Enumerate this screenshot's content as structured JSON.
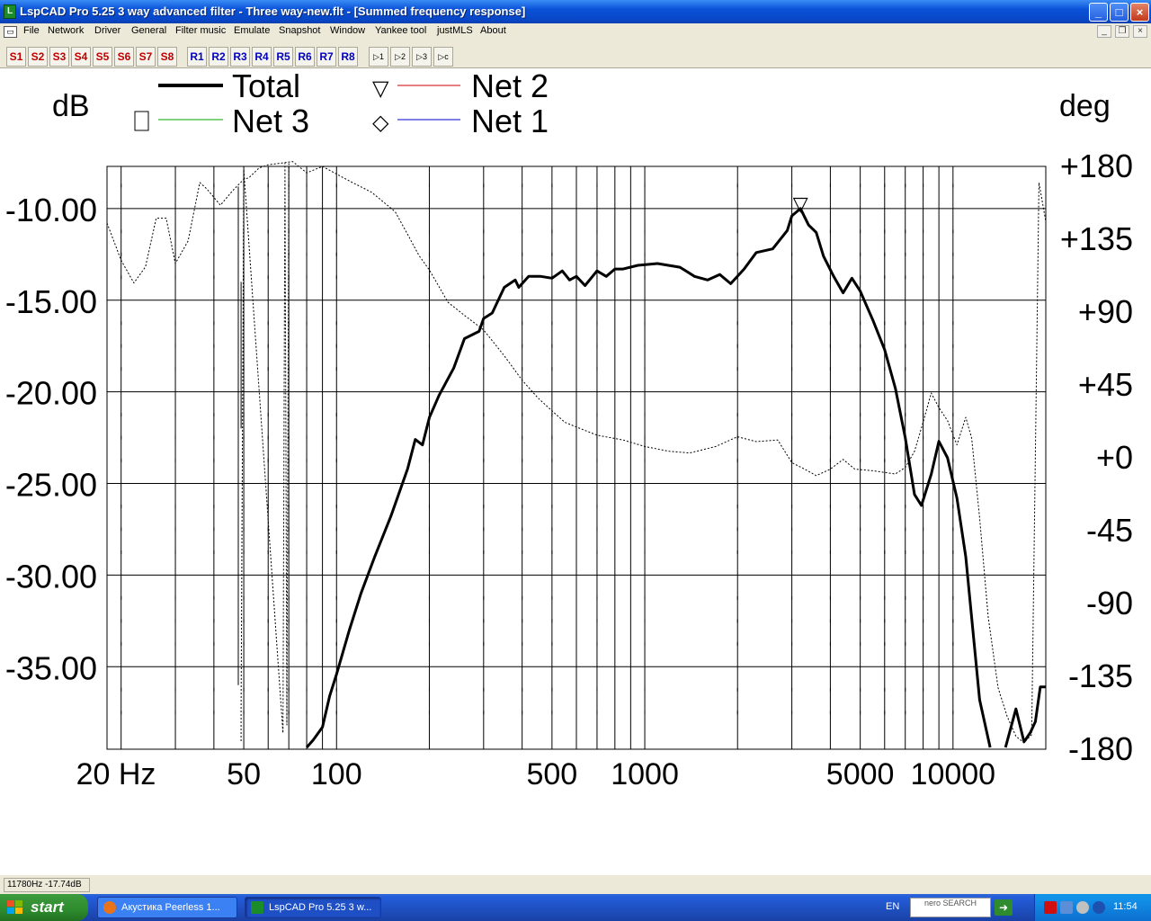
{
  "window": {
    "title": "LspCAD Pro 5.25 3 way advanced filter - Three way-new.flt - [Summed frequency response]",
    "min_label": "_",
    "max_label": "□",
    "close_label": "×"
  },
  "menu": [
    {
      "label": "File",
      "x": 26
    },
    {
      "label": "Network",
      "x": 53
    },
    {
      "label": "Driver",
      "x": 105
    },
    {
      "label": "General",
      "x": 146
    },
    {
      "label": "Filter music",
      "x": 195
    },
    {
      "label": "Emulate",
      "x": 260
    },
    {
      "label": "Snapshot",
      "x": 310
    },
    {
      "label": "Window",
      "x": 367
    },
    {
      "label": "Yankee tool",
      "x": 417
    },
    {
      "label": "justMLS",
      "x": 486
    },
    {
      "label": "About",
      "x": 534
    }
  ],
  "toolbar": {
    "s_buttons": [
      "S1",
      "S2",
      "S3",
      "S4",
      "S5",
      "S6",
      "S7",
      "S8"
    ],
    "r_buttons": [
      "R1",
      "R2",
      "R3",
      "R4",
      "R5",
      "R6",
      "R7",
      "R8"
    ],
    "f_buttons": [
      "▷1",
      "▷2",
      "▷3",
      "▷c"
    ]
  },
  "colors": {
    "total": "#000000",
    "net1": "#0000cc",
    "net2": "#cc0000",
    "net3": "#00aa00",
    "phase": "#000000"
  },
  "legend": {
    "total": "Total",
    "net2": "Net 2",
    "net3": "Net 3",
    "net1": "Net 1",
    "marker_net2": "▽",
    "marker_net3": "□",
    "marker_net1": "◇"
  },
  "chart_data": {
    "type": "line",
    "x_scale": "log",
    "xlim": [
      18,
      20000
    ],
    "ylim_left": [
      -39.5,
      -7.7
    ],
    "ylim_right": [
      -180,
      180
    ],
    "ylabel_left": "dB",
    "ylabel_right": "deg",
    "x_ticks": [
      {
        "v": 20,
        "label": "20 Hz"
      },
      {
        "v": 50,
        "label": "50"
      },
      {
        "v": 100,
        "label": "100"
      },
      {
        "v": 500,
        "label": "500"
      },
      {
        "v": 1000,
        "label": "1000"
      },
      {
        "v": 5000,
        "label": "5000"
      },
      {
        "v": 10000,
        "label": "10000"
      }
    ],
    "y_ticks_left": [
      {
        "v": -10,
        "label": "-10.00"
      },
      {
        "v": -15,
        "label": "-15.00"
      },
      {
        "v": -20,
        "label": "-20.00"
      },
      {
        "v": -25,
        "label": "-25.00"
      },
      {
        "v": -30,
        "label": "-30.00"
      },
      {
        "v": -35,
        "label": "-35.00"
      }
    ],
    "y_ticks_right": [
      {
        "v": 180,
        "label": "+180"
      },
      {
        "v": 135,
        "label": "+135"
      },
      {
        "v": 90,
        "label": "+90"
      },
      {
        "v": 45,
        "label": "+45"
      },
      {
        "v": 0,
        "label": "+0"
      },
      {
        "v": -45,
        "label": "-45"
      },
      {
        "v": -90,
        "label": "-90"
      },
      {
        "v": -135,
        "label": "-135"
      },
      {
        "v": -180,
        "label": "-180"
      }
    ],
    "grid": true,
    "series": [
      {
        "name": "Total",
        "axis": "left",
        "style": "solid",
        "points": [
          [
            80,
            -39.4
          ],
          [
            84,
            -39
          ],
          [
            90,
            -38.3
          ],
          [
            95,
            -36.6
          ],
          [
            100,
            -35.4
          ],
          [
            110,
            -33
          ],
          [
            120,
            -31
          ],
          [
            133,
            -29
          ],
          [
            150,
            -26.8
          ],
          [
            170,
            -24.2
          ],
          [
            180,
            -22.6
          ],
          [
            190,
            -22.9
          ],
          [
            200,
            -21.4
          ],
          [
            215,
            -20.2
          ],
          [
            240,
            -18.7
          ],
          [
            260,
            -17.1
          ],
          [
            290,
            -16.7
          ],
          [
            300,
            -16
          ],
          [
            320,
            -15.7
          ],
          [
            350,
            -14.3
          ],
          [
            380,
            -13.9
          ],
          [
            390,
            -14.3
          ],
          [
            420,
            -13.7
          ],
          [
            460,
            -13.7
          ],
          [
            500,
            -13.8
          ],
          [
            540,
            -13.4
          ],
          [
            570,
            -13.9
          ],
          [
            600,
            -13.7
          ],
          [
            640,
            -14.2
          ],
          [
            700,
            -13.4
          ],
          [
            750,
            -13.7
          ],
          [
            800,
            -13.3
          ],
          [
            850,
            -13.3
          ],
          [
            950,
            -13.1
          ],
          [
            1100,
            -13
          ],
          [
            1300,
            -13.2
          ],
          [
            1450,
            -13.7
          ],
          [
            1600,
            -13.9
          ],
          [
            1750,
            -13.6
          ],
          [
            1900,
            -14.1
          ],
          [
            2100,
            -13.3
          ],
          [
            2300,
            -12.4
          ],
          [
            2600,
            -12.2
          ],
          [
            2900,
            -11.2
          ],
          [
            3000,
            -10.4
          ],
          [
            3200,
            -10.0
          ],
          [
            3400,
            -10.9
          ],
          [
            3600,
            -11.3
          ],
          [
            3800,
            -12.6
          ],
          [
            4100,
            -13.7
          ],
          [
            4400,
            -14.6
          ],
          [
            4700,
            -13.8
          ],
          [
            5000,
            -14.5
          ],
          [
            5500,
            -16.1
          ],
          [
            6000,
            -17.7
          ],
          [
            6500,
            -19.8
          ],
          [
            7000,
            -22.5
          ],
          [
            7500,
            -25.6
          ],
          [
            7900,
            -26.2
          ],
          [
            8500,
            -24.5
          ],
          [
            9000,
            -22.7
          ],
          [
            9600,
            -23.6
          ],
          [
            10300,
            -25.8
          ],
          [
            11000,
            -29
          ],
          [
            11600,
            -33
          ],
          [
            12200,
            -36.8
          ],
          [
            12800,
            -38.4
          ],
          [
            13200,
            -39.4
          ]
        ]
      },
      {
        "name": "Total",
        "axis": "left",
        "style": "solid",
        "points": [
          [
            14800,
            -39.4
          ],
          [
            16000,
            -37.3
          ],
          [
            17000,
            -39.1
          ],
          [
            17800,
            -38.6
          ],
          [
            18500,
            -38.0
          ],
          [
            19200,
            -36.1
          ],
          [
            20000,
            -36.1
          ]
        ]
      },
      {
        "name": "phase",
        "axis": "right",
        "style": "dashed",
        "points": [
          [
            18,
            145
          ],
          [
            20,
            122
          ],
          [
            22,
            108
          ],
          [
            24,
            118
          ],
          [
            26,
            148
          ],
          [
            28,
            148
          ],
          [
            30,
            120
          ],
          [
            33,
            134
          ],
          [
            36,
            170
          ],
          [
            38,
            166
          ],
          [
            42,
            156
          ],
          [
            46,
            165
          ],
          [
            50,
            172
          ],
          [
            52,
            173
          ],
          [
            56,
            179
          ],
          [
            60,
            181
          ],
          [
            66,
            182
          ],
          [
            72,
            183
          ],
          [
            80,
            176
          ],
          [
            90,
            180
          ],
          [
            110,
            171
          ],
          [
            130,
            164
          ],
          [
            155,
            152
          ],
          [
            170,
            138
          ],
          [
            185,
            125
          ],
          [
            200,
            116
          ],
          [
            230,
            96
          ],
          [
            260,
            88
          ],
          [
            300,
            79
          ],
          [
            350,
            63
          ],
          [
            400,
            48
          ],
          [
            450,
            37
          ],
          [
            500,
            29
          ],
          [
            550,
            22
          ],
          [
            600,
            19
          ],
          [
            700,
            14
          ],
          [
            850,
            11
          ],
          [
            1000,
            7
          ],
          [
            1200,
            4
          ],
          [
            1400,
            3
          ],
          [
            1700,
            7
          ],
          [
            2000,
            13
          ],
          [
            2300,
            10
          ],
          [
            2700,
            11
          ],
          [
            3000,
            -3
          ],
          [
            3300,
            -7
          ],
          [
            3600,
            -11
          ],
          [
            4000,
            -7
          ],
          [
            4400,
            -1
          ],
          [
            4800,
            -7
          ],
          [
            5500,
            -8
          ],
          [
            6500,
            -10
          ],
          [
            7000,
            -6
          ],
          [
            7500,
            4
          ],
          [
            8000,
            22
          ],
          [
            8500,
            40
          ],
          [
            9000,
            31
          ],
          [
            9600,
            23
          ],
          [
            10300,
            8
          ],
          [
            11000,
            25
          ],
          [
            11500,
            12
          ],
          [
            12200,
            -37
          ],
          [
            13000,
            -98
          ],
          [
            14000,
            -142
          ],
          [
            15000,
            -160
          ],
          [
            16000,
            -172
          ],
          [
            17000,
            -176
          ],
          [
            18000,
            -171
          ],
          [
            19000,
            170
          ],
          [
            20000,
            146
          ]
        ]
      },
      {
        "name": "phase",
        "axis": "right",
        "style": "dashed",
        "points": [
          [
            49,
            -175
          ],
          [
            49,
            -155
          ],
          [
            50,
            178
          ],
          [
            67,
            -170
          ],
          [
            68,
            182
          ],
          [
            69,
            -165
          ],
          [
            70,
            182
          ]
        ]
      },
      {
        "name": "marker-line",
        "axis": "left",
        "style": "solid",
        "points": [
          [
            48,
            -36
          ],
          [
            48,
            -8.8
          ]
        ]
      },
      {
        "name": "marker-line",
        "axis": "left",
        "style": "solid",
        "points": [
          [
            49,
            -22
          ],
          [
            49,
            -14
          ]
        ]
      }
    ],
    "markers": [
      {
        "name": "Net 2",
        "x": 3200,
        "y": -10.0,
        "symbol": "▽"
      }
    ]
  },
  "status": {
    "readout": "11780Hz -17.74dB"
  },
  "taskbar": {
    "start_label": "start",
    "tasks": [
      "Акустика Peerless 1...",
      "LspCAD Pro 5.25 3 w..."
    ],
    "lang": "EN",
    "nero": "nero SEARCH",
    "clock": "11:54"
  }
}
